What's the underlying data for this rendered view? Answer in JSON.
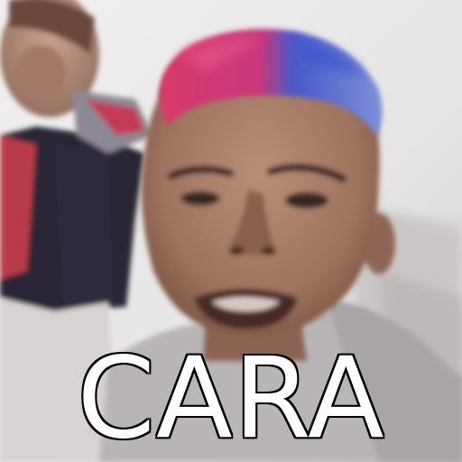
{
  "caption": {
    "text": "CARA",
    "color": "#ffffff",
    "outline_color": "#000000"
  },
  "scene": {
    "hair_colors": [
      "#e0336b",
      "#3e5fd1"
    ],
    "background_color": "#e8e6e6"
  }
}
